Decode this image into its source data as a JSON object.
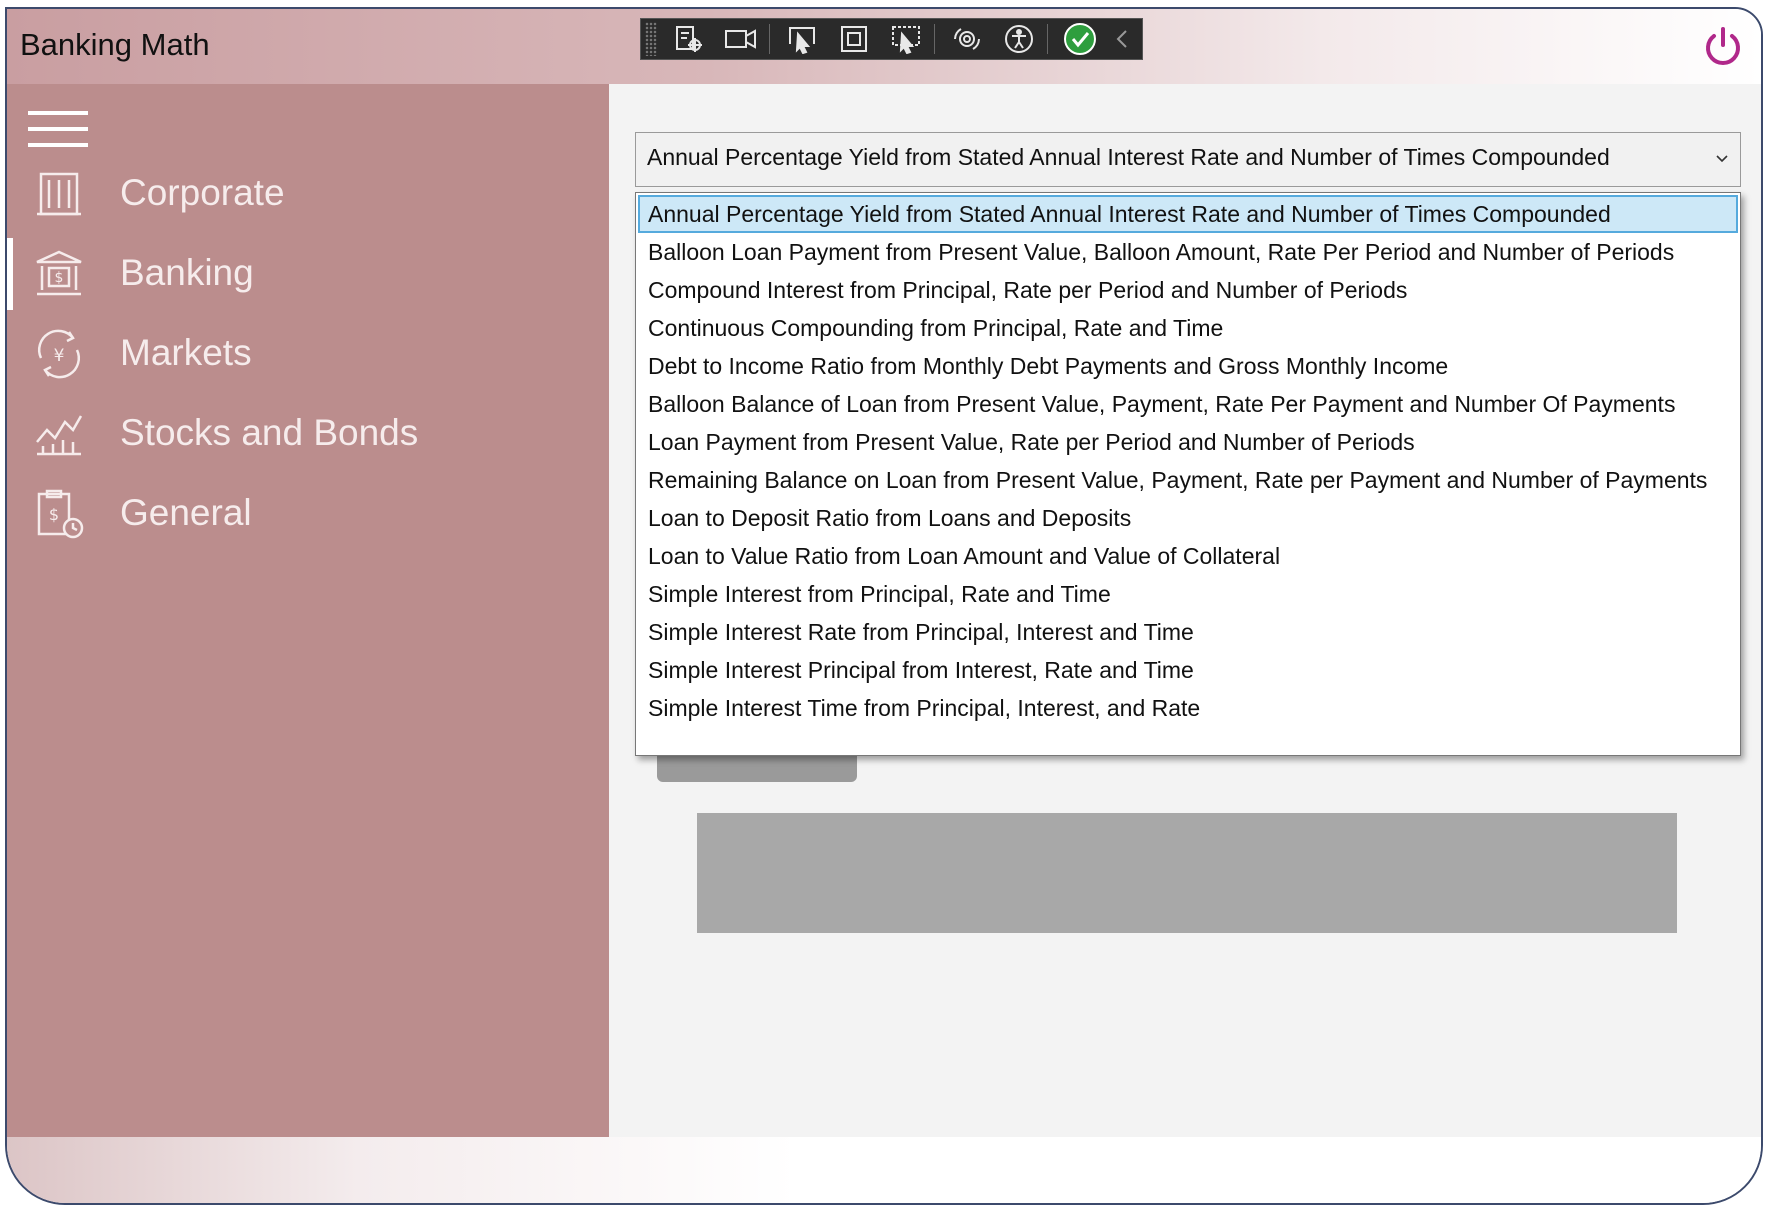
{
  "app": {
    "title": "Banking Math",
    "accent_color": "#b0288a",
    "sidebar_color": "#bb8d8d"
  },
  "sidebar": {
    "menu_icon": "hamburger-icon",
    "items": [
      {
        "label": "Corporate",
        "icon": "building-icon",
        "active": false
      },
      {
        "label": "Banking",
        "icon": "bank-icon",
        "active": true
      },
      {
        "label": "Markets",
        "icon": "yen-cycle-icon",
        "active": false
      },
      {
        "label": "Stocks and Bonds",
        "icon": "stock-chart-icon",
        "active": false
      },
      {
        "label": "General",
        "icon": "dollar-clipboard-icon",
        "active": false
      }
    ]
  },
  "formula_select": {
    "selected": "Annual Percentage Yield from Stated Annual Interest Rate and Number of Times Compounded",
    "options": [
      "Annual Percentage Yield from Stated Annual Interest Rate and Number of Times Compounded",
      "Balloon Loan Payment from Present Value, Balloon Amount, Rate Per Period and Number of Periods",
      "Compound Interest from Principal, Rate per Period and Number of Periods",
      "Continuous Compounding from Principal, Rate and Time",
      "Debt to Income Ratio from Monthly Debt Payments and Gross Monthly Income",
      "Balloon Balance of Loan from Present Value, Payment, Rate Per Payment and Number Of Payments",
      "Loan Payment from Present Value, Rate per Period and Number of Periods",
      "Remaining Balance on Loan from Present Value, Payment, Rate per Payment and Number of Payments",
      "Loan to Deposit Ratio from Loans and Deposits",
      "Loan to Value Ratio from Loan Amount and Value of Collateral",
      "Simple Interest from Principal, Rate and Time",
      "Simple Interest Rate from Principal, Interest and Time",
      "Simple Interest Principal from Interest, Rate and Time",
      "Simple Interest Time from Principal, Interest, and Rate"
    ]
  },
  "dev_toolbar": {
    "icons": [
      "live-visual-tree-icon",
      "record-icon",
      "select-element-icon",
      "display-layout-adorners-icon",
      "track-focus-icon",
      "hot-reload-icon",
      "accessibility-icon",
      "binding-ok-icon",
      "collapse-chevron-icon"
    ]
  }
}
